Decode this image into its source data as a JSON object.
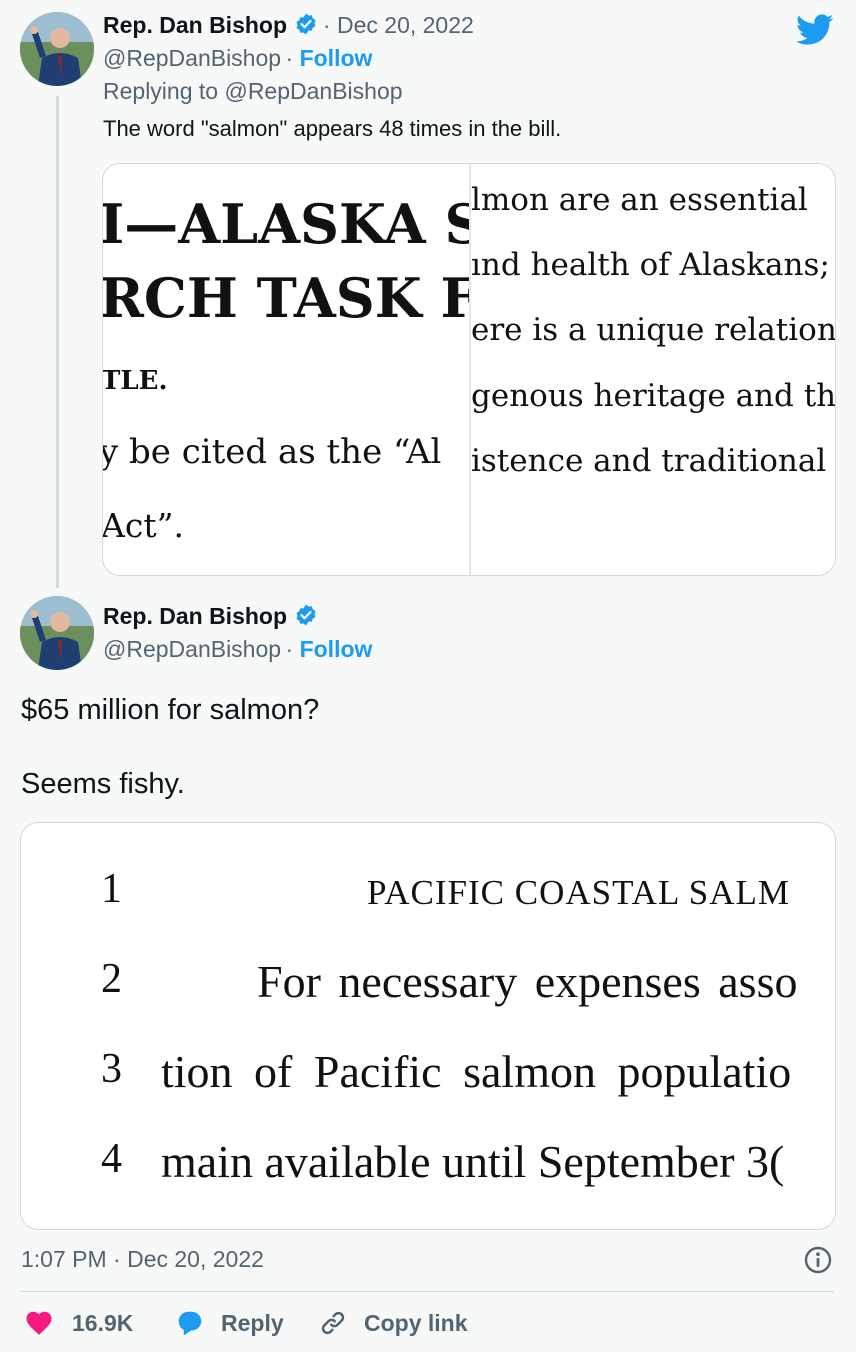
{
  "reply_tweet": {
    "author_name": "Rep. Dan Bishop",
    "handle": "@RepDanBishop",
    "date": "Dec 20, 2022",
    "follow_label": "Follow",
    "replying_to_prefix": "Replying to",
    "replying_to_handle": "@RepDanBishop",
    "text": "The word \"salmon\" appears 48 times in the bill.",
    "image_left": {
      "line1": "I—ALASKA S.",
      "line2": "RCH TASK F",
      "line3": "TLE.",
      "line4": "y be cited as the “Al",
      "line5": "Act”."
    },
    "image_right": {
      "line1": "lmon are an essential",
      "line2": "ınd health of Alaskans; a",
      "line3": "ere is a unique relations",
      "line4": "genous heritage and the",
      "line5": "istence and traditional a"
    }
  },
  "main_tweet": {
    "author_name": "Rep. Dan Bishop",
    "handle": "@RepDanBishop",
    "follow_label": "Follow",
    "text_line1": "$65 million for salmon?",
    "text_line2": "Seems fishy.",
    "bill_image": {
      "lines": [
        {
          "num": "1",
          "text": "PACIFIC COASTAL SALM"
        },
        {
          "num": "2",
          "text": "For necessary expenses asso"
        },
        {
          "num": "3",
          "text": "tion of Pacific salmon populatio"
        },
        {
          "num": "4",
          "text": "main available until September 3("
        }
      ]
    },
    "timestamp": "1:07 PM · Dec 20, 2022",
    "likes": "16.9K",
    "reply_label": "Reply",
    "copy_link_label": "Copy link"
  },
  "colors": {
    "accent": "#1d9bf0",
    "like": "#f91880",
    "muted": "#536471"
  },
  "icons": [
    "twitter-bird-icon",
    "verified-badge-icon",
    "heart-icon",
    "reply-bubble-icon",
    "link-icon",
    "info-icon"
  ]
}
